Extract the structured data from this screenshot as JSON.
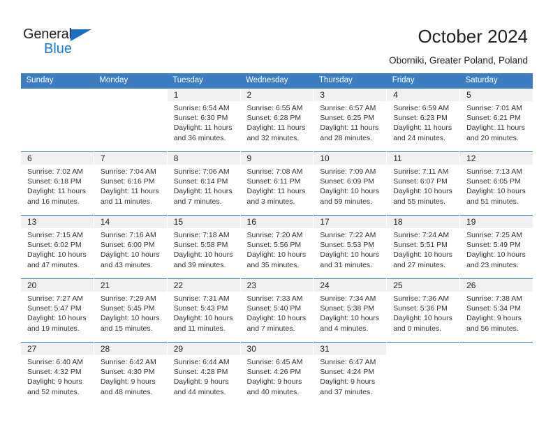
{
  "brand": {
    "name_part1": "General",
    "name_part2": "Blue",
    "accent_color": "#1b7bd0",
    "header_color": "#3b7dc0"
  },
  "header": {
    "title": "October 2024",
    "subtitle": "Oborniki, Greater Poland, Poland"
  },
  "weekday_headers": [
    "Sunday",
    "Monday",
    "Tuesday",
    "Wednesday",
    "Thursday",
    "Friday",
    "Saturday"
  ],
  "weeks": [
    [
      {
        "day": "",
        "sunrise": "",
        "sunset": "",
        "daylight1": "",
        "daylight2": ""
      },
      {
        "day": "",
        "sunrise": "",
        "sunset": "",
        "daylight1": "",
        "daylight2": ""
      },
      {
        "day": "1",
        "sunrise": "Sunrise: 6:54 AM",
        "sunset": "Sunset: 6:30 PM",
        "daylight1": "Daylight: 11 hours",
        "daylight2": "and 36 minutes."
      },
      {
        "day": "2",
        "sunrise": "Sunrise: 6:55 AM",
        "sunset": "Sunset: 6:28 PM",
        "daylight1": "Daylight: 11 hours",
        "daylight2": "and 32 minutes."
      },
      {
        "day": "3",
        "sunrise": "Sunrise: 6:57 AM",
        "sunset": "Sunset: 6:25 PM",
        "daylight1": "Daylight: 11 hours",
        "daylight2": "and 28 minutes."
      },
      {
        "day": "4",
        "sunrise": "Sunrise: 6:59 AM",
        "sunset": "Sunset: 6:23 PM",
        "daylight1": "Daylight: 11 hours",
        "daylight2": "and 24 minutes."
      },
      {
        "day": "5",
        "sunrise": "Sunrise: 7:01 AM",
        "sunset": "Sunset: 6:21 PM",
        "daylight1": "Daylight: 11 hours",
        "daylight2": "and 20 minutes."
      }
    ],
    [
      {
        "day": "6",
        "sunrise": "Sunrise: 7:02 AM",
        "sunset": "Sunset: 6:18 PM",
        "daylight1": "Daylight: 11 hours",
        "daylight2": "and 16 minutes."
      },
      {
        "day": "7",
        "sunrise": "Sunrise: 7:04 AM",
        "sunset": "Sunset: 6:16 PM",
        "daylight1": "Daylight: 11 hours",
        "daylight2": "and 11 minutes."
      },
      {
        "day": "8",
        "sunrise": "Sunrise: 7:06 AM",
        "sunset": "Sunset: 6:14 PM",
        "daylight1": "Daylight: 11 hours",
        "daylight2": "and 7 minutes."
      },
      {
        "day": "9",
        "sunrise": "Sunrise: 7:08 AM",
        "sunset": "Sunset: 6:11 PM",
        "daylight1": "Daylight: 11 hours",
        "daylight2": "and 3 minutes."
      },
      {
        "day": "10",
        "sunrise": "Sunrise: 7:09 AM",
        "sunset": "Sunset: 6:09 PM",
        "daylight1": "Daylight: 10 hours",
        "daylight2": "and 59 minutes."
      },
      {
        "day": "11",
        "sunrise": "Sunrise: 7:11 AM",
        "sunset": "Sunset: 6:07 PM",
        "daylight1": "Daylight: 10 hours",
        "daylight2": "and 55 minutes."
      },
      {
        "day": "12",
        "sunrise": "Sunrise: 7:13 AM",
        "sunset": "Sunset: 6:05 PM",
        "daylight1": "Daylight: 10 hours",
        "daylight2": "and 51 minutes."
      }
    ],
    [
      {
        "day": "13",
        "sunrise": "Sunrise: 7:15 AM",
        "sunset": "Sunset: 6:02 PM",
        "daylight1": "Daylight: 10 hours",
        "daylight2": "and 47 minutes."
      },
      {
        "day": "14",
        "sunrise": "Sunrise: 7:16 AM",
        "sunset": "Sunset: 6:00 PM",
        "daylight1": "Daylight: 10 hours",
        "daylight2": "and 43 minutes."
      },
      {
        "day": "15",
        "sunrise": "Sunrise: 7:18 AM",
        "sunset": "Sunset: 5:58 PM",
        "daylight1": "Daylight: 10 hours",
        "daylight2": "and 39 minutes."
      },
      {
        "day": "16",
        "sunrise": "Sunrise: 7:20 AM",
        "sunset": "Sunset: 5:56 PM",
        "daylight1": "Daylight: 10 hours",
        "daylight2": "and 35 minutes."
      },
      {
        "day": "17",
        "sunrise": "Sunrise: 7:22 AM",
        "sunset": "Sunset: 5:53 PM",
        "daylight1": "Daylight: 10 hours",
        "daylight2": "and 31 minutes."
      },
      {
        "day": "18",
        "sunrise": "Sunrise: 7:24 AM",
        "sunset": "Sunset: 5:51 PM",
        "daylight1": "Daylight: 10 hours",
        "daylight2": "and 27 minutes."
      },
      {
        "day": "19",
        "sunrise": "Sunrise: 7:25 AM",
        "sunset": "Sunset: 5:49 PM",
        "daylight1": "Daylight: 10 hours",
        "daylight2": "and 23 minutes."
      }
    ],
    [
      {
        "day": "20",
        "sunrise": "Sunrise: 7:27 AM",
        "sunset": "Sunset: 5:47 PM",
        "daylight1": "Daylight: 10 hours",
        "daylight2": "and 19 minutes."
      },
      {
        "day": "21",
        "sunrise": "Sunrise: 7:29 AM",
        "sunset": "Sunset: 5:45 PM",
        "daylight1": "Daylight: 10 hours",
        "daylight2": "and 15 minutes."
      },
      {
        "day": "22",
        "sunrise": "Sunrise: 7:31 AM",
        "sunset": "Sunset: 5:43 PM",
        "daylight1": "Daylight: 10 hours",
        "daylight2": "and 11 minutes."
      },
      {
        "day": "23",
        "sunrise": "Sunrise: 7:33 AM",
        "sunset": "Sunset: 5:40 PM",
        "daylight1": "Daylight: 10 hours",
        "daylight2": "and 7 minutes."
      },
      {
        "day": "24",
        "sunrise": "Sunrise: 7:34 AM",
        "sunset": "Sunset: 5:38 PM",
        "daylight1": "Daylight: 10 hours",
        "daylight2": "and 4 minutes."
      },
      {
        "day": "25",
        "sunrise": "Sunrise: 7:36 AM",
        "sunset": "Sunset: 5:36 PM",
        "daylight1": "Daylight: 10 hours",
        "daylight2": "and 0 minutes."
      },
      {
        "day": "26",
        "sunrise": "Sunrise: 7:38 AM",
        "sunset": "Sunset: 5:34 PM",
        "daylight1": "Daylight: 9 hours",
        "daylight2": "and 56 minutes."
      }
    ],
    [
      {
        "day": "27",
        "sunrise": "Sunrise: 6:40 AM",
        "sunset": "Sunset: 4:32 PM",
        "daylight1": "Daylight: 9 hours",
        "daylight2": "and 52 minutes."
      },
      {
        "day": "28",
        "sunrise": "Sunrise: 6:42 AM",
        "sunset": "Sunset: 4:30 PM",
        "daylight1": "Daylight: 9 hours",
        "daylight2": "and 48 minutes."
      },
      {
        "day": "29",
        "sunrise": "Sunrise: 6:44 AM",
        "sunset": "Sunset: 4:28 PM",
        "daylight1": "Daylight: 9 hours",
        "daylight2": "and 44 minutes."
      },
      {
        "day": "30",
        "sunrise": "Sunrise: 6:45 AM",
        "sunset": "Sunset: 4:26 PM",
        "daylight1": "Daylight: 9 hours",
        "daylight2": "and 40 minutes."
      },
      {
        "day": "31",
        "sunrise": "Sunrise: 6:47 AM",
        "sunset": "Sunset: 4:24 PM",
        "daylight1": "Daylight: 9 hours",
        "daylight2": "and 37 minutes."
      },
      {
        "day": "",
        "sunrise": "",
        "sunset": "",
        "daylight1": "",
        "daylight2": ""
      },
      {
        "day": "",
        "sunrise": "",
        "sunset": "",
        "daylight1": "",
        "daylight2": ""
      }
    ]
  ]
}
